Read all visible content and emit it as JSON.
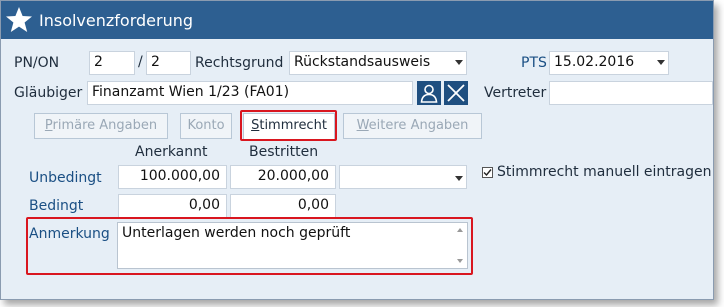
{
  "window": {
    "title": "Insolvenzforderung"
  },
  "header": {
    "pn_on_label": "PN/ON",
    "pn_value": "2",
    "separator": "/",
    "on_value": "2",
    "rechtsgrund_label": "Rechtsgrund",
    "rechtsgrund_value": "Rückstandsausweis",
    "pts_label": "PTS",
    "pts_value": "15.02.2016",
    "glaeubiger_label": "Gläubiger",
    "glaeubiger_value": "Finanzamt Wien 1/23 (FA01)",
    "vertreter_label": "Vertreter",
    "vertreter_value": ""
  },
  "tabs": [
    {
      "label_pre": "",
      "label_ul": "P",
      "label_post": "rimäre Angaben",
      "active": false
    },
    {
      "label_pre": "",
      "label_ul": "",
      "label_post": "Konto",
      "active": false
    },
    {
      "label_pre": "",
      "label_ul": "S",
      "label_post": "timmrecht",
      "active": true
    },
    {
      "label_pre": "",
      "label_ul": "W",
      "label_post": "eitere Angaben",
      "active": false
    }
  ],
  "stimmrecht": {
    "col_anerkannt": "Anerkannt",
    "col_bestritten": "Bestritten",
    "row_unbedingt_label": "Unbedingt",
    "unbedingt_anerkannt": "100.000,00",
    "unbedingt_bestritten": "20.000,00",
    "unbedingt_select": "",
    "row_bedingt_label": "Bedingt",
    "bedingt_anerkannt": "0,00",
    "bedingt_bestritten": "0,00",
    "manual_checkbox_label": "Stimmrecht manuell eintragen",
    "manual_checked": true,
    "anmerkung_label": "Anmerkung",
    "anmerkung_value": "Unterlagen werden noch geprüft"
  },
  "colors": {
    "titlebar": "#2d5f91",
    "background": "#e6eef6",
    "highlight": "#d9161f",
    "icon_button": "#1f4f80"
  },
  "icons": [
    "star-icon",
    "person-icon",
    "close-icon",
    "chevron-down-icon",
    "checkmark-icon"
  ]
}
